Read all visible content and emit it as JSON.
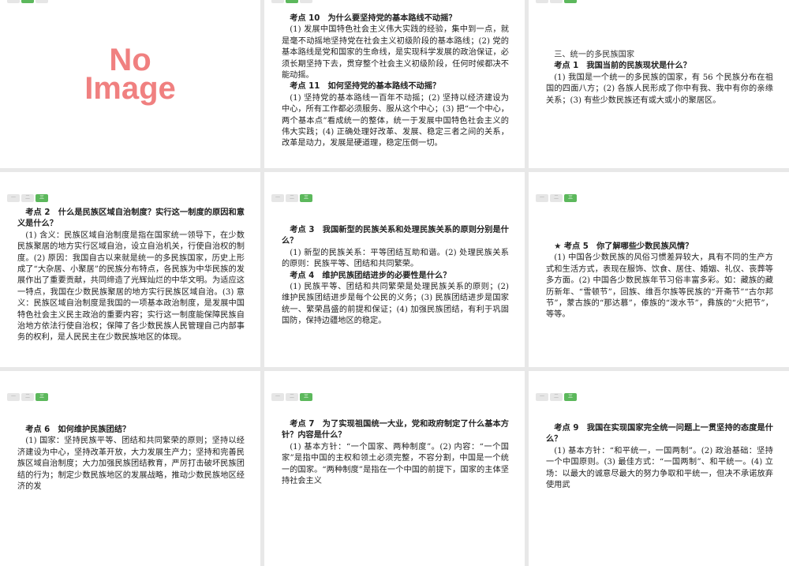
{
  "tabs": [
    "一",
    "二",
    "三"
  ],
  "slides": [
    {
      "placeholder": [
        "No",
        "Image"
      ]
    },
    {
      "blocks": [
        {
          "type": "h",
          "text": "考点 10　为什么要坚持党的基本路线不动摇？"
        },
        {
          "type": "p",
          "text": "(1) 发展中国特色社会主义伟大实践的经验，集中到一点，就是毫不动摇地坚持党在社会主义初级阶段的基本路线；(2) 党的基本路线是党和国家的生命线，是实现科学发展的政治保证，必须长期坚持下去，贯穿整个社会主义初级阶段，任何时候都决不能动摇。"
        },
        {
          "type": "h",
          "text": "考点 11　如何坚持党的基本路线不动摇？"
        },
        {
          "type": "p",
          "text": "(1) 坚持党的基本路线一百年不动摇；(2) 坚持以经济建设为中心，所有工作都必须服务、服从这个中心；(3) 把“一个中心，两个基本点”看成统一的整体，统一于发展中国特色社会主义的伟大实践；(4) 正确处理好改革、发展、稳定三者之间的关系，改革是动力，发展是硬道理，稳定压倒一切。"
        }
      ]
    },
    {
      "blocks": [
        {
          "type": "plain",
          "text": "三、统一的多民族国家"
        },
        {
          "type": "h",
          "text": "考点 1　我国当前的民族现状是什么？"
        },
        {
          "type": "p",
          "text": "(1) 我国是一个统一的多民族的国家，有 56 个民族分布在祖国的四面八方；(2) 各族人民形成了你中有我、我中有你的亲缘关系；(3) 有些少数民族还有或大或小的聚居区。"
        }
      ]
    },
    {
      "blocks": [
        {
          "type": "h",
          "text": "考点 2　什么是民族区域自治制度？实行这一制度的原因和意义是什么？"
        },
        {
          "type": "p",
          "text": "(1) 含义：民族区域自治制度是指在国家统一领导下，在少数民族聚居的地方实行区域自治，设立自治机关，行使自治权的制度。(2) 原因：我国自古以来就是统一的多民族国家，历史上形成了“大杂居、小聚居”的民族分布特点，各民族为中华民族的发展作出了重要贡献，共同缔造了光辉灿烂的中华文明。为适应这一特点，我国在少数民族聚居的地方实行民族区域自治。(3) 意义：民族区域自治制度是我国的一项基本政治制度，是发展中国特色社会主义民主政治的重要内容；实行这一制度能保障民族自治地方依法行使自治权；保障了各少数民族人民管理自己内部事务的权利，是人民民主在少数民族地区的体现。"
        }
      ]
    },
    {
      "blocks": [
        {
          "type": "h",
          "text": "考点 3　我国新型的民族关系和处理民族关系的原则分别是什么？"
        },
        {
          "type": "p",
          "text": "(1) 新型的民族关系：平等团结互助和谐。(2) 处理民族关系的原则：民族平等、团结和共同繁荣。"
        },
        {
          "type": "h",
          "text": "考点 4　维护民族团结进步的必要性是什么？"
        },
        {
          "type": "p",
          "text": "(1) 民族平等、团结和共同繁荣是处理民族关系的原则；(2) 维护民族团结进步是每个公民的义务；(3) 民族团结进步是国家统一、繁荣昌盛的前提和保证；(4) 加强民族团结，有利于巩固国防，保持边疆地区的稳定。"
        }
      ]
    },
    {
      "blocks": [
        {
          "type": "h",
          "text": "★ 考点 5　你了解哪些少数民族风情？"
        },
        {
          "type": "p",
          "text": "(1) 中国各少数民族的风俗习惯差异较大，具有不同的生产方式和生活方式，表现在服饰、饮食、居住、婚姻、礼仪、丧葬等多方面。(2) 中国各少数民族年节习俗丰富多彩。如：藏族的藏历新年、“雪顿节”，回族、维吾尔族等民族的“开斋节”“古尔邦节”，蒙古族的“那达慕”，傣族的“泼水节”，彝族的“火把节”，等等。"
        }
      ]
    },
    {
      "blocks": [
        {
          "type": "h",
          "text": "考点 6　如何维护民族团结？"
        },
        {
          "type": "p",
          "text": "(1) 国家：坚持民族平等、团结和共同繁荣的原则；坚持以经济建设为中心，坚持改革开放，大力发展生产力；坚持和完善民族区域自治制度；大力加强民族团结教育，严厉打击破坏民族团结的行为；制定少数民族地区的发展战略，推动少数民族地区经济的发"
        }
      ]
    },
    {
      "blocks": [
        {
          "type": "h",
          "text": "考点 7　为了实现祖国统一大业，党和政府制定了什么基本方针？内容是什么？"
        },
        {
          "type": "p",
          "text": "(1) 基本方针：“一个国家、两种制度”。(2) 内容：“一个国家”是指中国的主权和领土必须完整，不容分割，中国是一个统一的国家。“两种制度”是指在一个中国的前提下，国家的主体坚持社会主义"
        }
      ]
    },
    {
      "blocks": [
        {
          "type": "h",
          "text": "考点 9　我国在实现国家完全统一问题上一贯坚持的态度是什么？"
        },
        {
          "type": "p",
          "text": "(1) 基本方针：“和平统一，一国两制”。(2) 政治基础：坚持一个中国原则。(3) 最佳方式：“一国两制”、和平统一。(4) 立场：以最大的诚意尽最大的努力争取和平统一，但决不承诺放弃使用武"
        }
      ]
    }
  ],
  "active_tab": [
    1,
    1,
    2,
    2,
    2,
    2,
    2,
    2,
    2
  ]
}
